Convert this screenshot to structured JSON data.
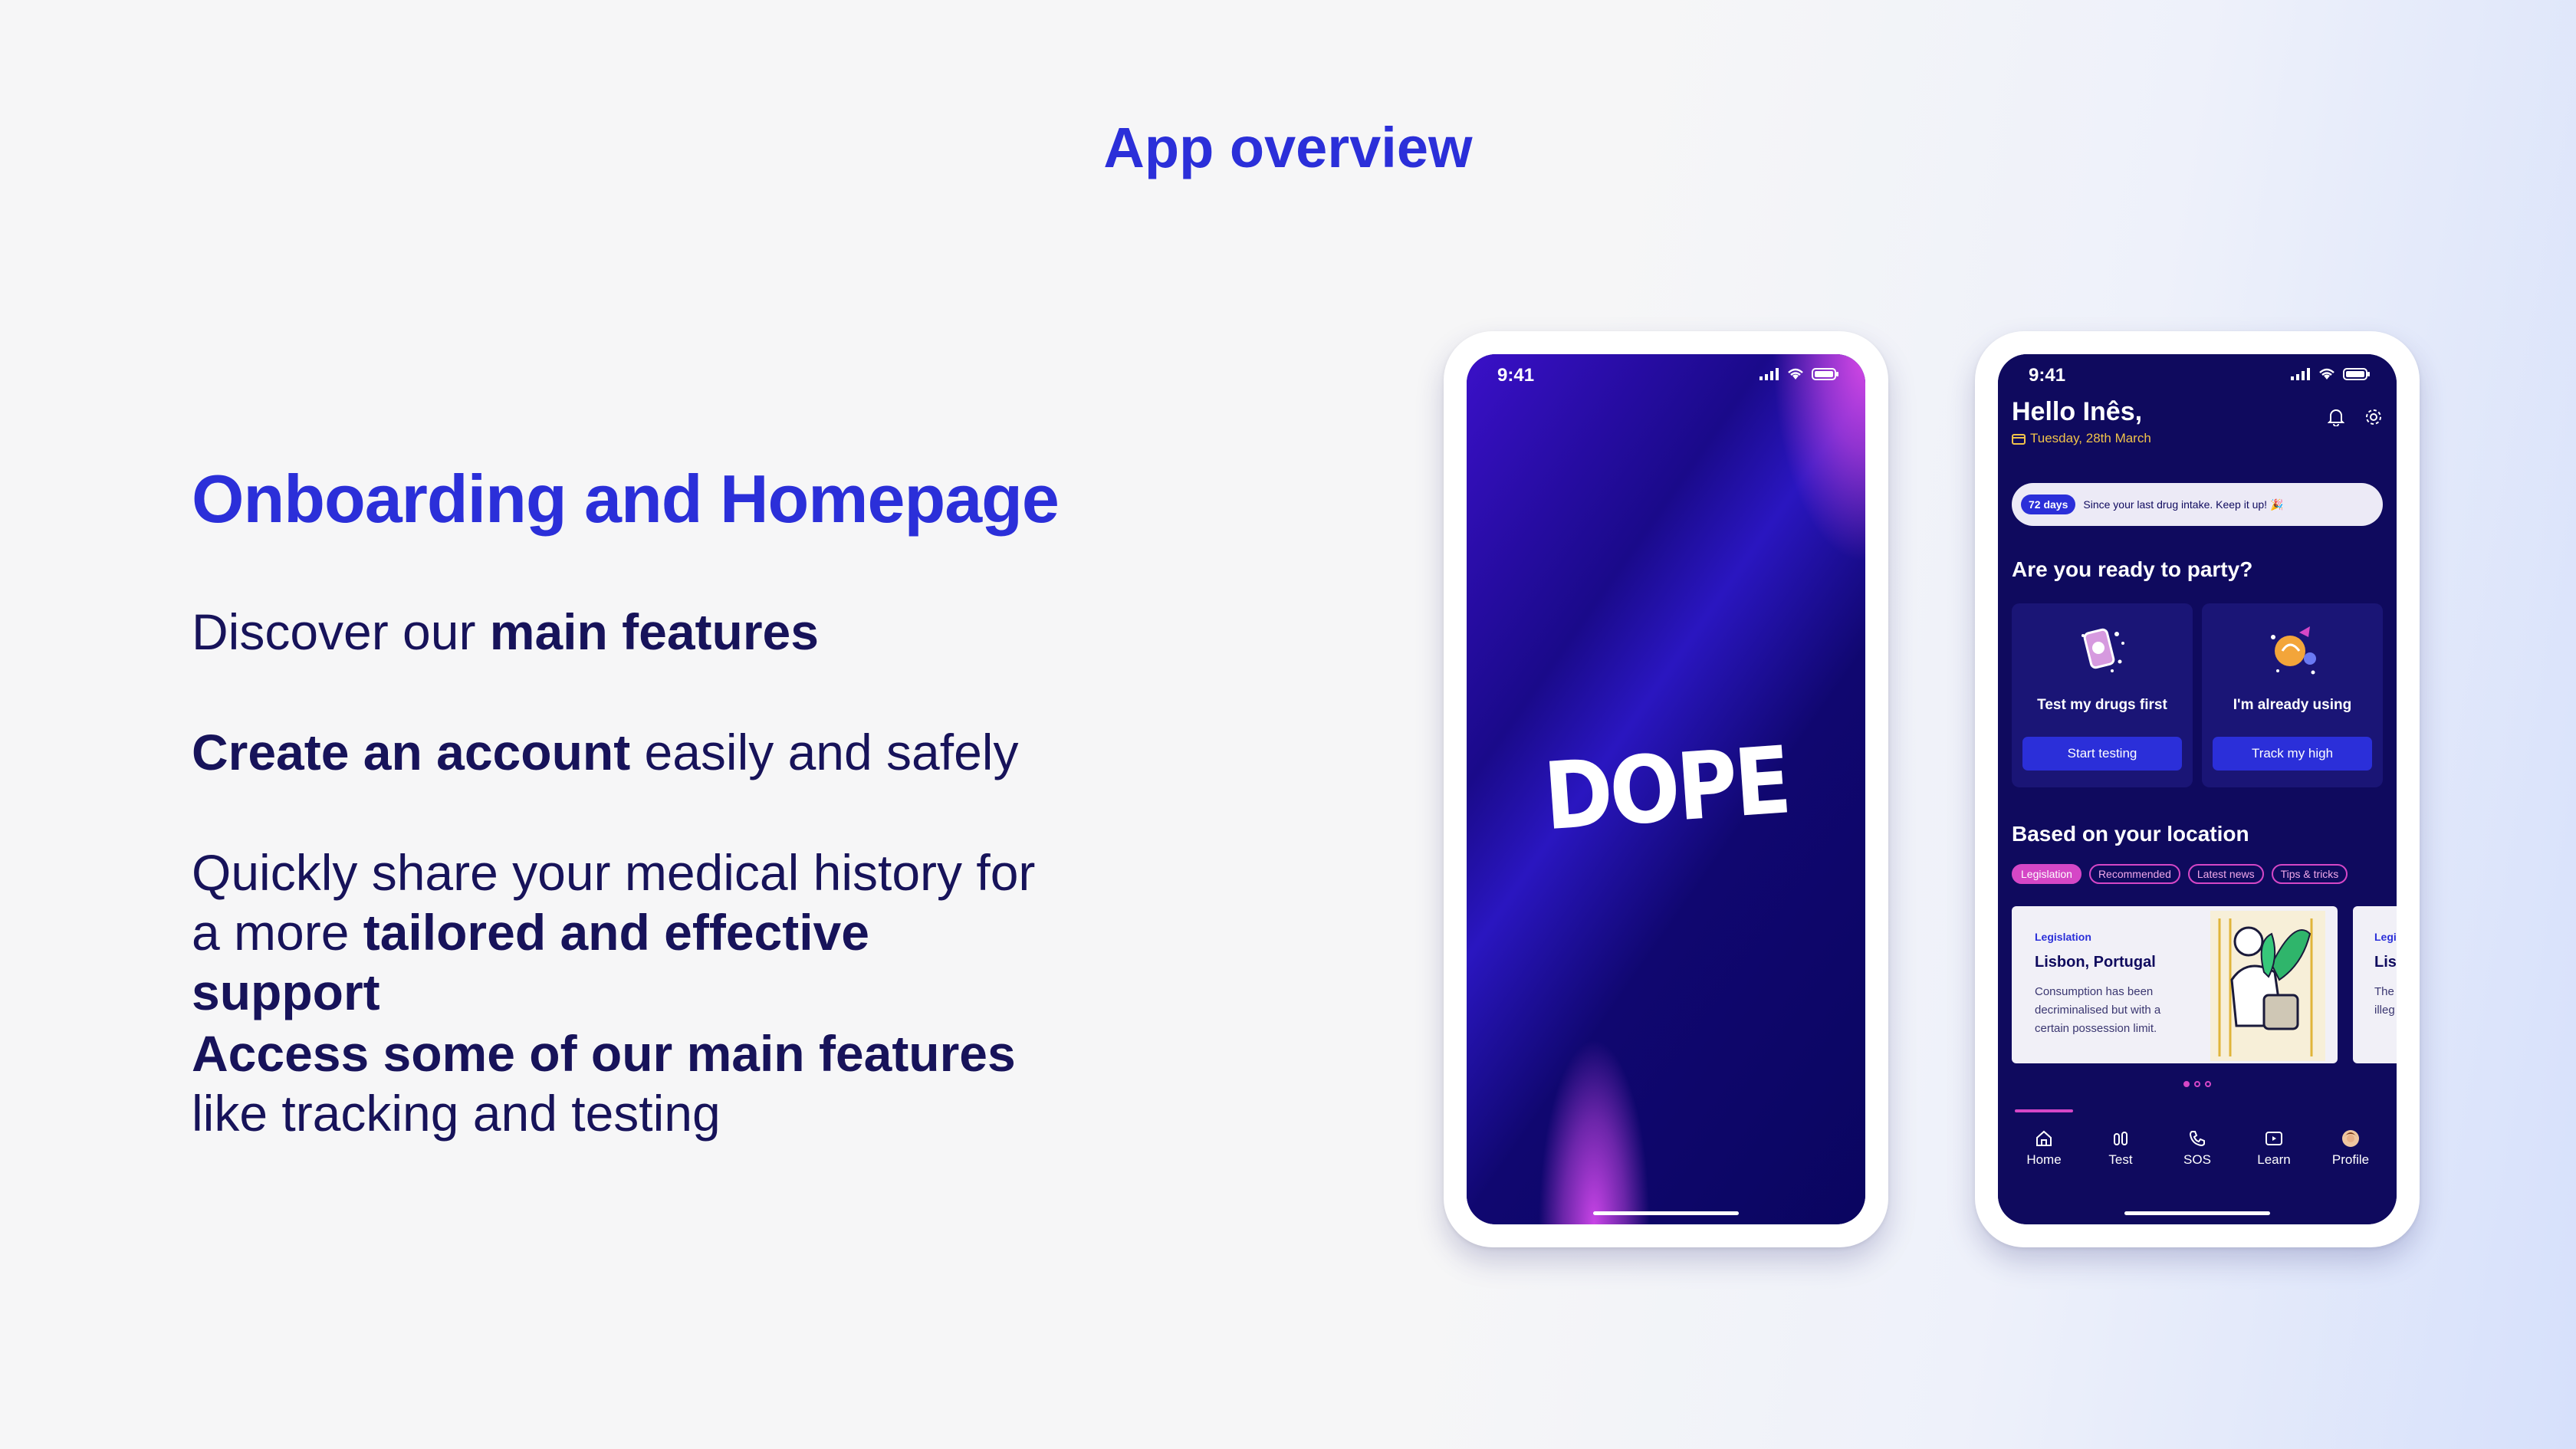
{
  "slide": {
    "title": "App overview",
    "section_title": "Onboarding and Homepage",
    "features": [
      {
        "pre": "Discover our ",
        "bold": "main features",
        "post": ""
      },
      {
        "pre": "",
        "bold": "Create an account",
        "post": " easily and safely"
      },
      {
        "pre": "Quickly share your medical history for a more ",
        "bold": "tailored and effective support",
        "post": ""
      },
      {
        "pre": "",
        "bold": "Access some of our main features",
        "post": " like tracking and testing"
      }
    ]
  },
  "splash_phone": {
    "time": "9:41",
    "logo_text": "DOPE"
  },
  "home_phone": {
    "time": "9:41",
    "greeting": "Hello Inês,",
    "date": "Tuesday, 28th March",
    "streak": {
      "badge": "72 days",
      "message": "Since your last drug intake. Keep it up! 🎉"
    },
    "party_heading": "Are you ready to party?",
    "cards": [
      {
        "title": "Test my drugs first",
        "button": "Start testing",
        "icon": "drug-test-illustration"
      },
      {
        "title": "I'm already using",
        "button": "Track my high",
        "icon": "tracking-illustration"
      }
    ],
    "location_heading": "Based on your location",
    "chips": [
      "Legislation",
      "Recommended",
      "Latest news",
      "Tips & tricks"
    ],
    "news": [
      {
        "category": "Legislation",
        "title": "Lisbon, Portugal",
        "body": "Consumption has been decriminalised but with a certain possession limit."
      },
      {
        "category": "Legi",
        "title": "Lisb",
        "body": "The illeg"
      }
    ],
    "tabs": [
      {
        "label": "Home",
        "icon": "home-icon"
      },
      {
        "label": "Test",
        "icon": "test-icon"
      },
      {
        "label": "SOS",
        "icon": "phone-icon"
      },
      {
        "label": "Learn",
        "icon": "play-icon"
      },
      {
        "label": "Profile",
        "icon": "avatar-icon"
      }
    ]
  },
  "colors": {
    "accent": "#2b2fd9",
    "navy": "#0f0a5e",
    "magenta": "#d547c6"
  }
}
